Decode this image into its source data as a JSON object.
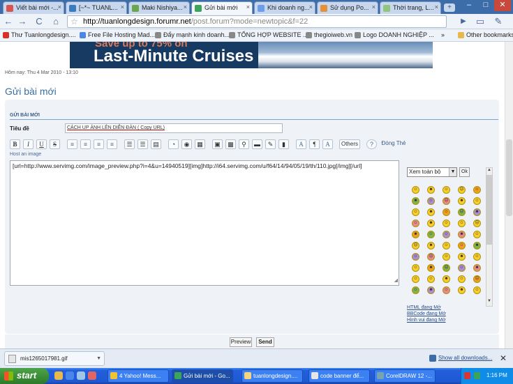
{
  "browser": {
    "tabs": [
      {
        "label": "Viết bài mới -...",
        "icon_color": "#d9534f"
      },
      {
        "label": "[~*~ TUANL...",
        "icon_color": "#3b7bbf"
      },
      {
        "label": "Maki Nishiya...",
        "icon_color": "#6aa84f"
      },
      {
        "label": "Gửi bài mới",
        "icon_color": "#3ca55c"
      },
      {
        "label": "Khi doanh ng...",
        "icon_color": "#6d9eeb"
      },
      {
        "label": "Sử dụng Po...",
        "icon_color": "#e69138"
      },
      {
        "label": "Thời trang, L...",
        "icon_color": "#93c47d"
      }
    ],
    "new_tab": "+",
    "window_buttons": {
      "minimize": "–",
      "maximize": "□",
      "close": "✕"
    },
    "url_host": "http://tuanlongdesign.forumr.net",
    "url_path": "/post.forum?mode=newtopic&f=22",
    "nav": {
      "back": "←",
      "forward": "→",
      "reload": "C",
      "home": "⌂",
      "go": "▶",
      "page": "▭",
      "wrench": "✎"
    },
    "bookmarks": [
      {
        "label": "Thư Tuanlongdesign....",
        "icon_color": "#d93025"
      },
      {
        "label": "Free File Hosting Mad...",
        "icon_color": "#4a86e8"
      },
      {
        "label": "Đẩy mạnh kinh doanh...",
        "icon_color": "#888888"
      },
      {
        "label": "TỔNG HỢP WEBSITE ...",
        "icon_color": "#888888"
      },
      {
        "label": "thegioiweb.vn",
        "icon_color": "#888888"
      },
      {
        "label": "Logo DOANH NGHIỆP ...",
        "icon_color": "#888888"
      }
    ],
    "bookmarks_more": "»",
    "other_bookmarks": "Other bookmarks"
  },
  "banner": {
    "line1": "Save up to 75% on",
    "line2": "Last-Minute Cruises"
  },
  "page": {
    "dateline": "Hôm nay: Thu 4 Mar 2010 - 13:10",
    "title": "Gửi bài mới",
    "form_heading": "GỬI BÀI MỚI",
    "title_label": "Tiêu đề",
    "title_value": "CÁCH UP ẢNH LÊN DIỄN ĐÀN ( Copy URL)",
    "editor_buttons": [
      "B",
      "I",
      "U",
      "S",
      "≡",
      "≡",
      "≡",
      "≡",
      "☰",
      "☰",
      "▤",
      "◔",
      "◉",
      "▦",
      "▣",
      "▩",
      "⚲",
      "▬",
      "✎",
      "▮",
      "A",
      "¶",
      "A"
    ],
    "others_label": "Others",
    "help_label": "?",
    "close_tags_label": "Đóng Thẻ",
    "host_label": "Host an image",
    "body_text": "[url=http://www.servimg.com/image_preview.php?i=4&u=14940519][img]http://i64.servimg.com/u/f64/14/94/05/19/th/110.jpg[/img][/url]",
    "smiley_select": "Xem toàn bộ",
    "smiley_ok": "Ok",
    "smiley_links": [
      "HTML đang Mở",
      "BBCode đang Mở",
      "Hình vui đang Mở"
    ],
    "preview_label": "Preview",
    "send_label": "Send"
  },
  "downloads": {
    "file": "mis1265017981.gif",
    "show_all": "Show all downloads...",
    "close": "✕"
  },
  "taskbar": {
    "start": "start",
    "items": [
      {
        "label": "4 Yahoo! Mess...",
        "icon_color": "#f1c232"
      },
      {
        "label": "Gửi bài mới - Go...",
        "icon_color": "#3ca55c"
      },
      {
        "label": "tuanlongdesign....",
        "icon_color": "#f6d37d"
      },
      {
        "label": "code banner để...",
        "icon_color": "#e6e6e6"
      },
      {
        "label": "CorelDRAW 12 -...",
        "icon_color": "#76a5af"
      }
    ],
    "clock": "1:16 PM"
  },
  "colors": {
    "accent": "#3b6fa0",
    "taskbar": "#245edb"
  }
}
